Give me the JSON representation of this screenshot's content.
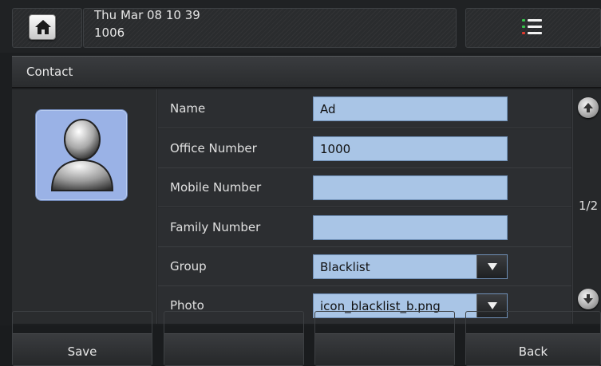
{
  "status": {
    "datetime": "Thu Mar 08 10 39",
    "extension": "1006",
    "home_icon": "home-icon",
    "menu_icon": "menu-list-icon"
  },
  "page": {
    "title": "Contact",
    "page_indicator": "1/2"
  },
  "avatar": {
    "icon": "person-icon",
    "background": "#9ab2e6"
  },
  "form": {
    "fields": [
      {
        "label": "Name",
        "value": "Ad",
        "type": "text"
      },
      {
        "label": "Office Number",
        "value": "1000",
        "type": "text"
      },
      {
        "label": "Mobile Number",
        "value": "",
        "type": "text"
      },
      {
        "label": "Family Number",
        "value": "",
        "type": "text"
      },
      {
        "label": "Group",
        "value": "Blacklist",
        "type": "select"
      },
      {
        "label": "Photo",
        "value": "icon_blacklist_b.png",
        "type": "select"
      }
    ]
  },
  "softkeys": {
    "save": "Save",
    "key2": "",
    "key3": "",
    "back": "Back"
  },
  "colors": {
    "field_bg": "#a9c5e6",
    "menu_accent_green": "#37c24a",
    "menu_accent_red": "#e03a2e"
  }
}
